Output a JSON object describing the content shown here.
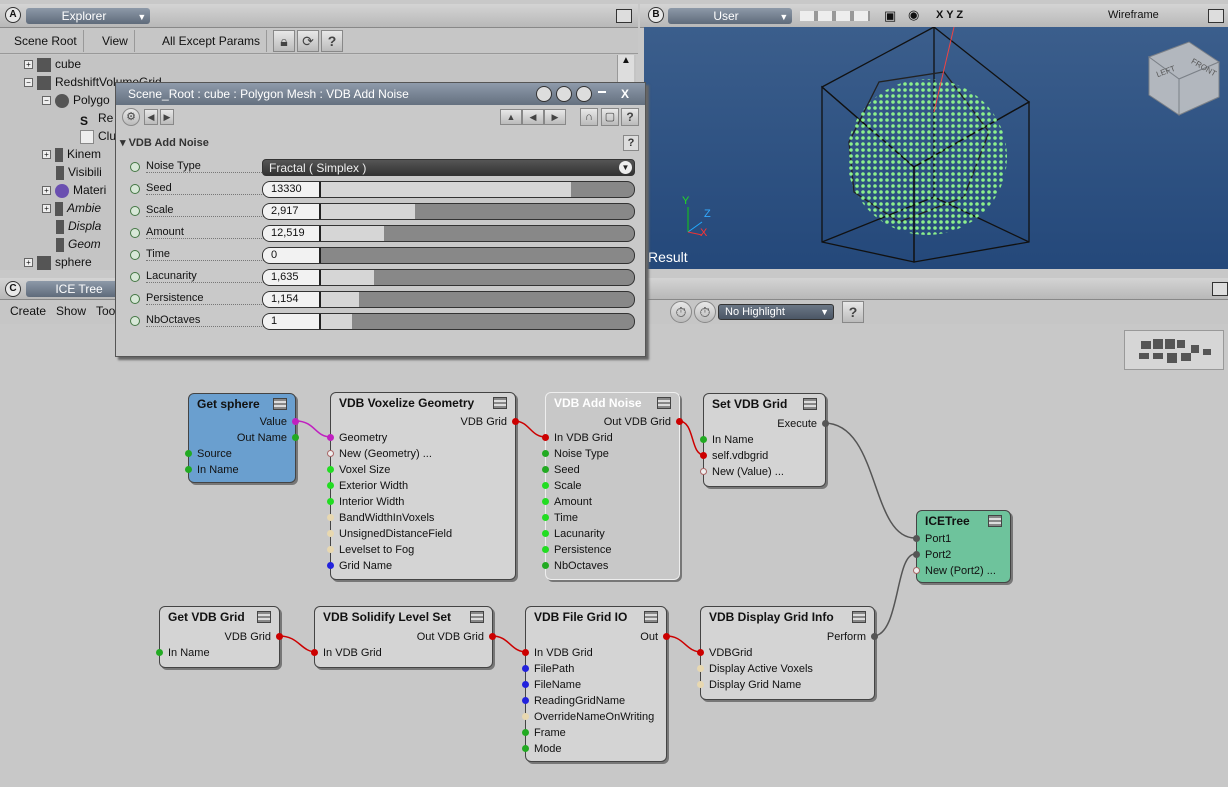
{
  "explorer": {
    "badge": "A",
    "title": "Explorer",
    "menu": [
      "Scene Root",
      "View",
      "All Except Params"
    ],
    "tree": [
      {
        "label": "cube",
        "indent": 0
      },
      {
        "label": "RedshiftVolumeGrid",
        "indent": 0
      },
      {
        "label": "Polygo",
        "indent": 1
      },
      {
        "label": "Re",
        "indent": 2
      },
      {
        "label": "Clu",
        "indent": 2
      },
      {
        "label": "Kinem",
        "indent": 1
      },
      {
        "label": "Visibili",
        "indent": 1
      },
      {
        "label": "Materi",
        "indent": 1
      },
      {
        "label": "Ambie",
        "indent": 1
      },
      {
        "label": "Displa",
        "indent": 1
      },
      {
        "label": "Geom",
        "indent": 1
      },
      {
        "label": "sphere",
        "indent": 0
      }
    ]
  },
  "viewport": {
    "badge": "B",
    "title": "User",
    "axes_label": "X Y Z",
    "mode": "Wireframe",
    "result_label": "Result",
    "cube_labels": [
      "LEFT",
      "FRONT"
    ],
    "gizmo": {
      "y": "Y",
      "z": "Z",
      "x": "X"
    }
  },
  "ice": {
    "badge": "C",
    "title": "ICE Tree",
    "menu": [
      "Create",
      "Show",
      "Tool"
    ],
    "highlight": "No Highlight"
  },
  "ppg": {
    "title": "Scene_Root : cube : Polygon Mesh : VDB Add Noise",
    "close": "X",
    "section": "VDB Add Noise",
    "params": [
      {
        "label": "Noise Type",
        "value": "Fractal ( Simplex )"
      },
      {
        "label": "Seed",
        "value": "13330",
        "fill": 0.8
      },
      {
        "label": "Scale",
        "value": "2,917",
        "fill": 0.3
      },
      {
        "label": "Amount",
        "value": "12,519",
        "fill": 0.2
      },
      {
        "label": "Time",
        "value": "0",
        "fill": 0.0
      },
      {
        "label": "Lacunarity",
        "value": "1,635",
        "fill": 0.17
      },
      {
        "label": "Persistence",
        "value": "1,154",
        "fill": 0.12
      },
      {
        "label": "NbOctaves",
        "value": "1",
        "fill": 0.1
      }
    ]
  },
  "nodes": {
    "get_sphere": {
      "title": "Get sphere",
      "outs": [
        "Value",
        "Out Name"
      ],
      "ins": [
        "Source",
        "In Name"
      ]
    },
    "voxelize": {
      "title": "VDB Voxelize Geometry",
      "outs": [
        "VDB Grid"
      ],
      "ins": [
        "Geometry",
        "New (Geometry) ...",
        "Voxel Size",
        "Exterior Width",
        "Interior Width",
        "BandWidthInVoxels",
        "UnsignedDistanceField",
        "Levelset to Fog",
        "Grid Name"
      ]
    },
    "add_noise": {
      "title": "VDB Add Noise",
      "outs": [
        "Out VDB Grid"
      ],
      "ins": [
        "In VDB Grid",
        "Noise Type",
        "Seed",
        "Scale",
        "Amount",
        "Time",
        "Lacunarity",
        "Persistence",
        "NbOctaves"
      ]
    },
    "set_grid": {
      "title": "Set VDB Grid",
      "outs": [
        "Execute"
      ],
      "ins": [
        "In Name",
        "self.vdbgrid",
        "New (Value) ..."
      ]
    },
    "icetree": {
      "title": "ICETree",
      "ins": [
        "Port1",
        "Port2",
        "New (Port2) ..."
      ]
    },
    "get_grid": {
      "title": "Get VDB Grid",
      "outs": [
        "VDB Grid"
      ],
      "ins": [
        "In Name"
      ]
    },
    "solidify": {
      "title": "VDB Solidify Level Set",
      "outs": [
        "Out VDB Grid"
      ],
      "ins": [
        "In VDB Grid"
      ]
    },
    "file_io": {
      "title": "VDB File Grid IO",
      "outs": [
        "Out"
      ],
      "ins": [
        "In VDB Grid",
        "FilePath",
        "FileName",
        "ReadingGridName",
        "OverrideNameOnWriting",
        "Frame",
        "Mode"
      ]
    },
    "display_info": {
      "title": "VDB Display Grid Info",
      "outs": [
        "Perform"
      ],
      "ins": [
        "VDBGrid",
        "Display Active Voxels",
        "Display Grid Name"
      ]
    }
  }
}
